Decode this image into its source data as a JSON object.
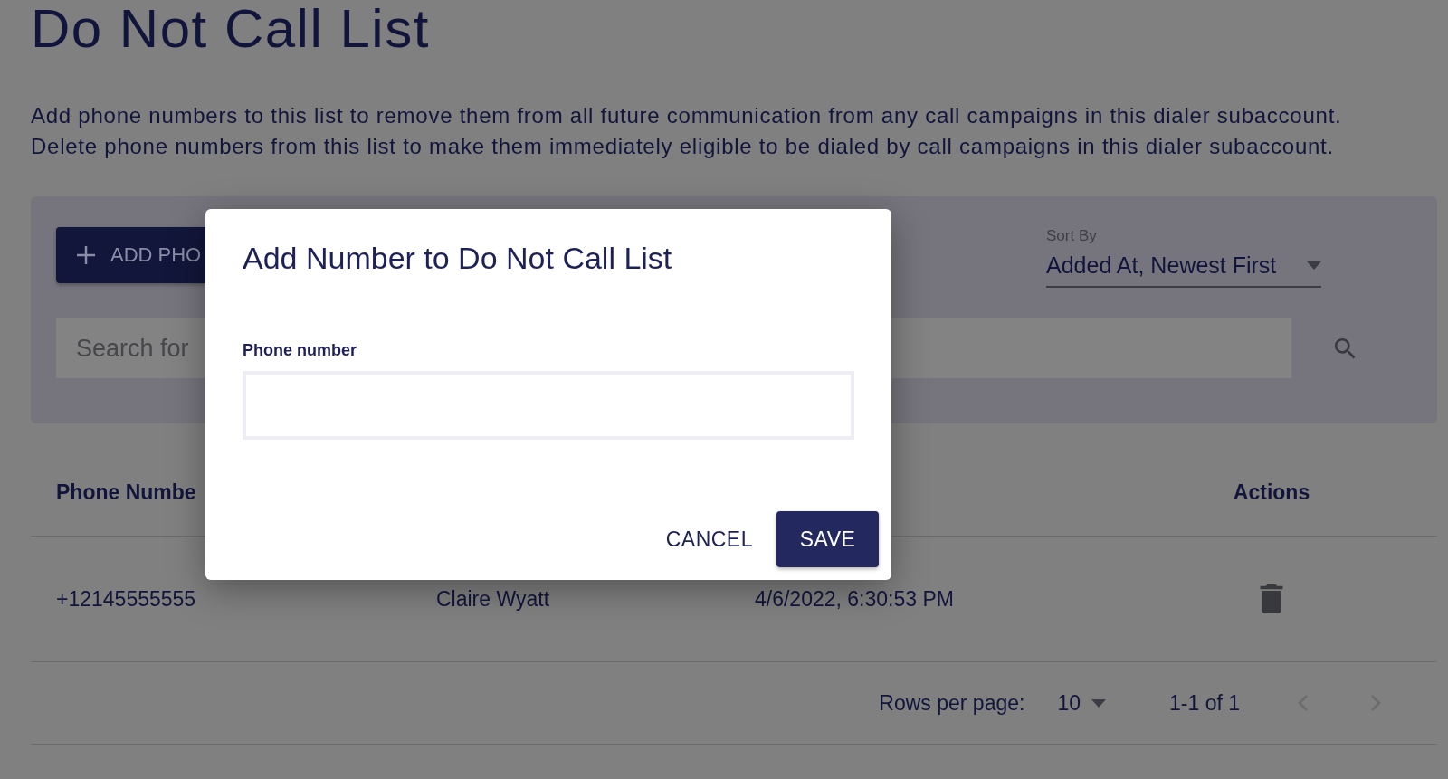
{
  "page": {
    "title": "Do Not Call List",
    "description": [
      "Add phone numbers to this list to remove them from all future communication from any call campaigns in this dialer subaccount.",
      "Delete phone numbers from this list to make them immediately eligible to be dialed by call campaigns in this dialer subaccount."
    ]
  },
  "toolbar": {
    "add_button": {
      "label": "ADD PHO"
    },
    "sort": {
      "label": "Sort By",
      "value": "Added At, Newest First"
    },
    "search": {
      "placeholder": "Search for"
    }
  },
  "table": {
    "columns": [
      "Phone Numbe",
      "Actions"
    ],
    "rows": [
      {
        "cells": [
          "+12145555555",
          "Claire Wyatt",
          "4/6/2022, 6:30:53 PM"
        ]
      }
    ]
  },
  "pagination": {
    "rows_per_page_label": "Rows per page:",
    "rows_per_page": "10",
    "range": "1-1 of 1"
  },
  "dialog": {
    "title": "Add Number to Do Not Call List",
    "field_label": "Phone number",
    "buttons": [
      {
        "label": "CANCEL",
        "kind": "text"
      },
      {
        "label": "SAVE",
        "kind": "primary"
      }
    ]
  }
}
